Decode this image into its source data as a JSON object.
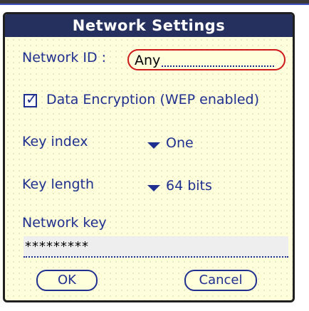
{
  "dialog": {
    "title": "Network Settings",
    "network_id_label": "Network ID :",
    "network_id_value": "Any",
    "encryption_label": "Data Encryption (WEP enabled)",
    "encryption_checked": true,
    "key_index_label": "Key index",
    "key_index_value": "One",
    "key_length_label": "Key length",
    "key_length_value": "64 bits",
    "network_key_label": "Network key",
    "network_key_value": "*********",
    "ok_label": "OK",
    "cancel_label": "Cancel"
  },
  "colors": {
    "title_bg": "#26305e",
    "dialog_bg": "#ffffdc",
    "text": "#1f2f8f",
    "focus_border": "#d01818"
  },
  "icons": {
    "checkbox": "checkbox-checked-icon",
    "dropdown": "dropdown-triangle-icon"
  }
}
